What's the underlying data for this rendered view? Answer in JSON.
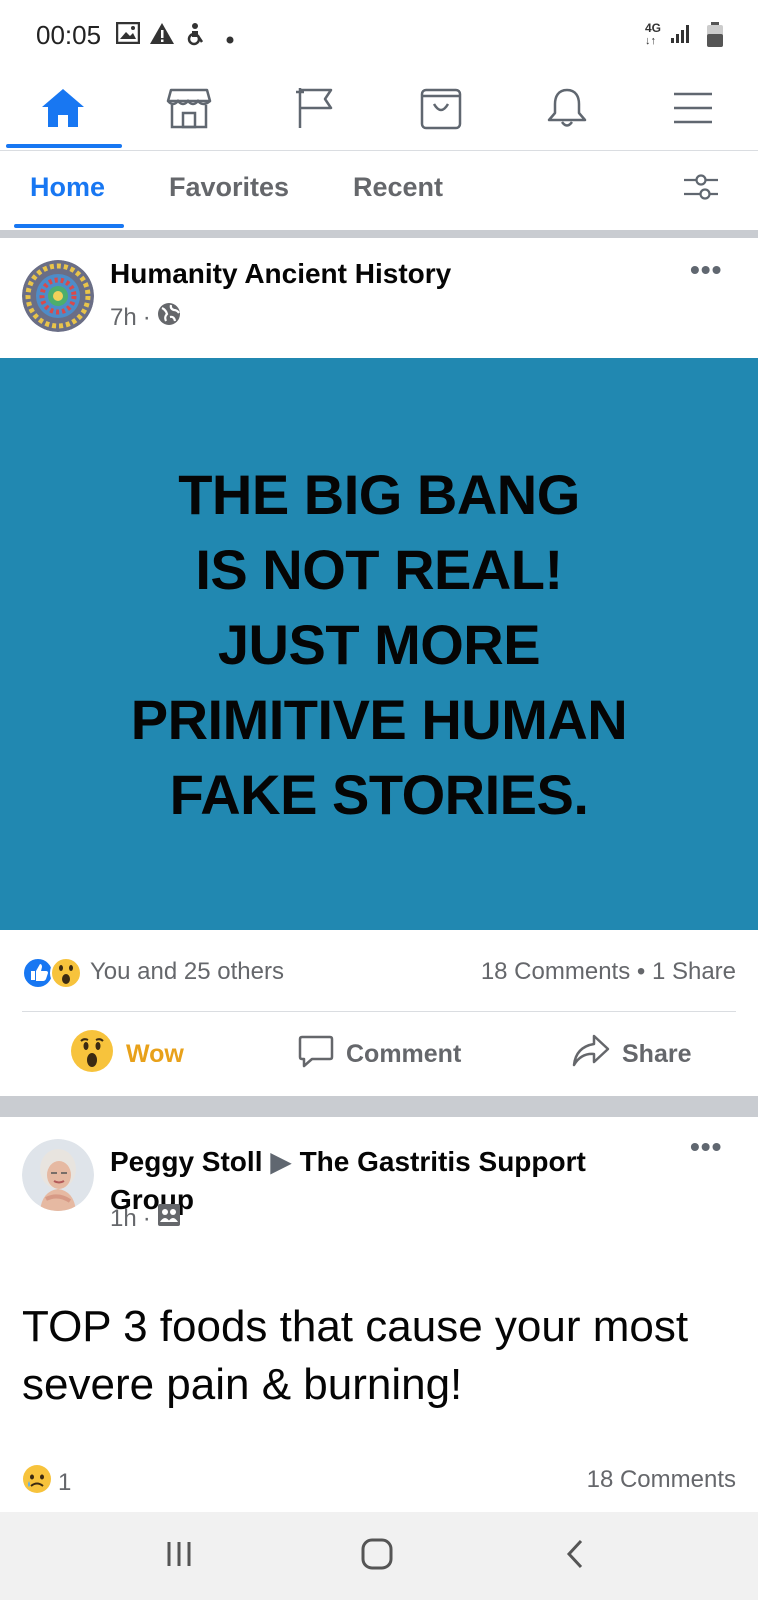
{
  "status_bar": {
    "time": "00:05",
    "left_icons": [
      "image-icon",
      "warning-icon",
      "accessibility-icon",
      "dot-icon"
    ],
    "network": "4G",
    "right_icons": [
      "signal-icon",
      "battery-icon"
    ]
  },
  "top_nav": {
    "items": [
      {
        "name": "home-icon",
        "active": true
      },
      {
        "name": "marketplace-icon",
        "active": false
      },
      {
        "name": "pages-flag-icon",
        "active": false
      },
      {
        "name": "shop-bag-icon",
        "active": false
      },
      {
        "name": "notifications-bell-icon",
        "active": false
      },
      {
        "name": "menu-icon",
        "active": false
      }
    ],
    "accent_color": "#1877f2"
  },
  "feed_tabs": {
    "tabs": [
      {
        "label": "Home",
        "active": true
      },
      {
        "label": "Favorites",
        "active": false
      },
      {
        "label": "Recent",
        "active": false
      }
    ],
    "filter_icon": "filter-sliders-icon"
  },
  "post1": {
    "author": "Humanity Ancient History",
    "time": "7h",
    "audience_icon": "globe-icon",
    "image_bg": "#2188b1",
    "image_lines": [
      "THE BIG BANG",
      "IS NOT REAL!",
      "JUST MORE",
      "PRIMITIVE HUMAN",
      "FAKE STORIES."
    ],
    "reactions_text": "You and 25 others",
    "reaction_icons": [
      "like-icon",
      "wow-icon"
    ],
    "counts": "18 Comments • 1 Share",
    "actions": {
      "wow": "Wow",
      "comment": "Comment",
      "share": "Share"
    }
  },
  "post2": {
    "author": "Peggy Stoll",
    "arrow": "▶",
    "group": "The Gastritis Support Group",
    "time": "1h",
    "audience_icon": "group-icon",
    "text": "TOP 3 foods that cause your most severe pain & burning!",
    "reaction_icon": "sad-icon",
    "reaction_count": "1",
    "comments": "18 Comments"
  },
  "system_nav": {
    "buttons": [
      "recent-apps-icon",
      "home-button-icon",
      "back-icon"
    ]
  }
}
